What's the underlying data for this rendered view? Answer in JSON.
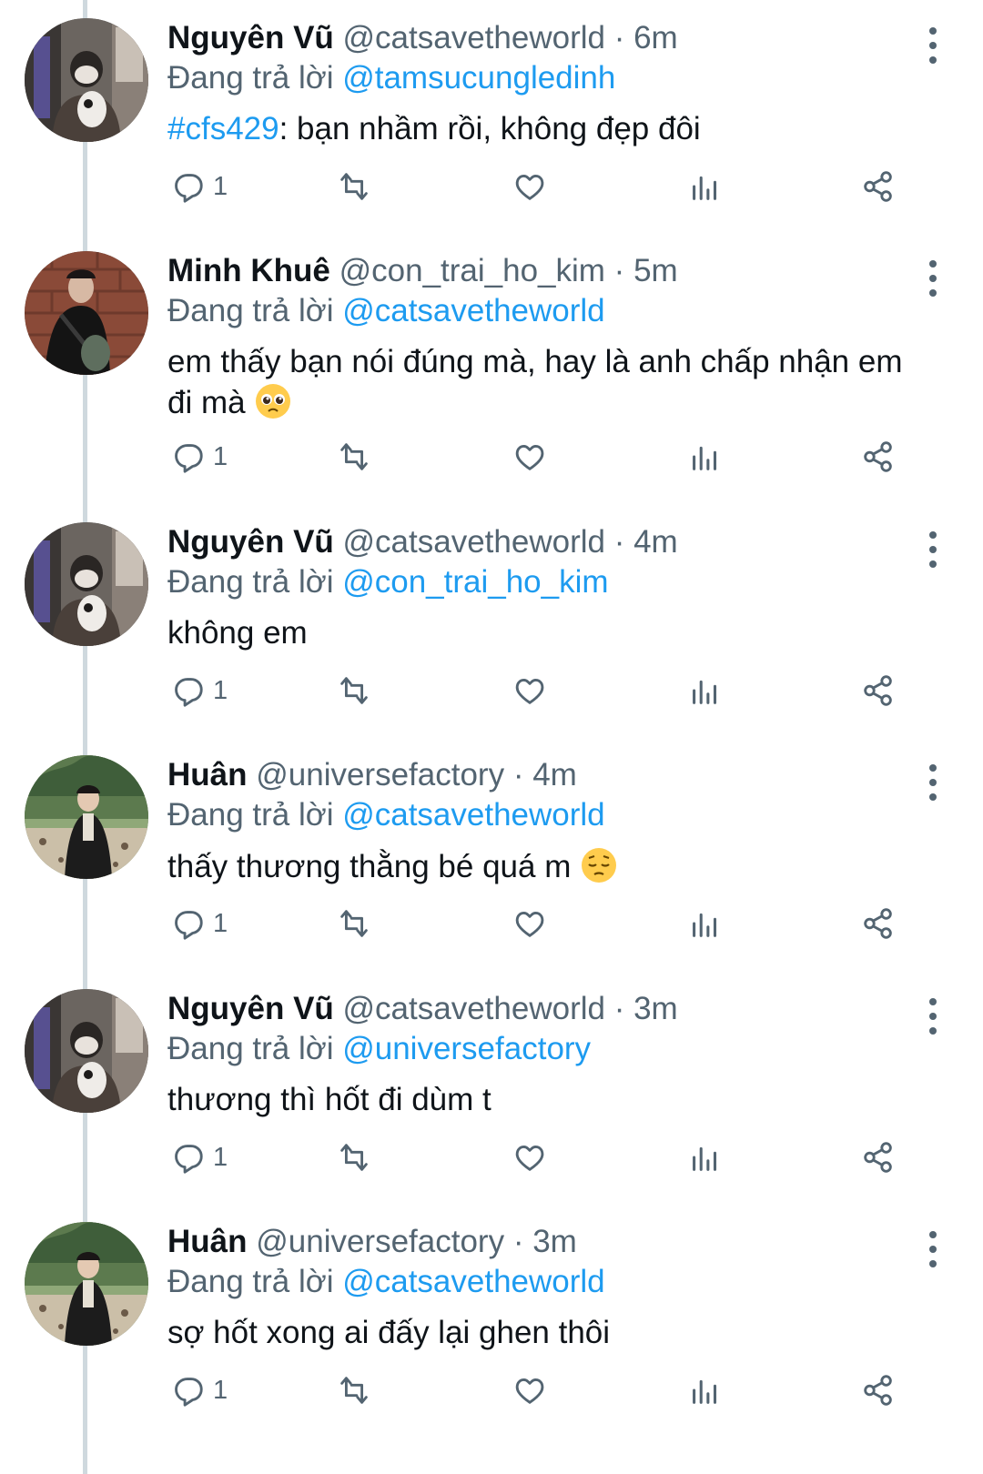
{
  "reply_prefix": "Đang trả lời",
  "colors": {
    "accent": "#1d9bf0",
    "text": "#0f1419",
    "muted": "#536471",
    "thread_line": "#cfd9de"
  },
  "tweets": [
    {
      "name": "Nguyên Vũ",
      "handle": "@catsavetheworld",
      "sep": " · ",
      "time": "6m",
      "reply_to": "@tamsucungledinh",
      "hashtag": "#cfs429",
      "text_rest": ": bạn nhầm rồi, không đẹp đôi",
      "reply_count": "1",
      "avatar": "avatar-nguyen-vu"
    },
    {
      "name": "Minh Khuê",
      "handle": "@con_trai_ho_kim",
      "sep": " · ",
      "time": "5m",
      "reply_to": "@catsavetheworld",
      "text": "em thấy bạn nói đúng mà, hay là anh chấp nhận em đi mà",
      "emoji": "pleading-face-emoji",
      "reply_count": "1",
      "avatar": "avatar-minh-khue"
    },
    {
      "name": "Nguyên Vũ",
      "handle": "@catsavetheworld",
      "sep": " · ",
      "time": "4m",
      "reply_to": "@con_trai_ho_kim",
      "text": "không em",
      "reply_count": "1",
      "avatar": "avatar-nguyen-vu"
    },
    {
      "name": "Huân",
      "handle": "@universefactory",
      "sep": " · ",
      "time": "4m",
      "reply_to": "@catsavetheworld",
      "text": "thấy thương thằng bé quá m",
      "emoji": "pensive-face-emoji",
      "reply_count": "1",
      "avatar": "avatar-huan"
    },
    {
      "name": "Nguyên Vũ",
      "handle": "@catsavetheworld",
      "sep": " · ",
      "time": "3m",
      "reply_to": "@universefactory",
      "text": "thương thì hốt đi dùm t",
      "reply_count": "1",
      "avatar": "avatar-nguyen-vu"
    },
    {
      "name": "Huân",
      "handle": "@universefactory",
      "sep": " · ",
      "time": "3m",
      "reply_to": "@catsavetheworld",
      "text": "sợ hốt xong ai đấy lại ghen thôi",
      "reply_count": "1",
      "avatar": "avatar-huan"
    }
  ]
}
